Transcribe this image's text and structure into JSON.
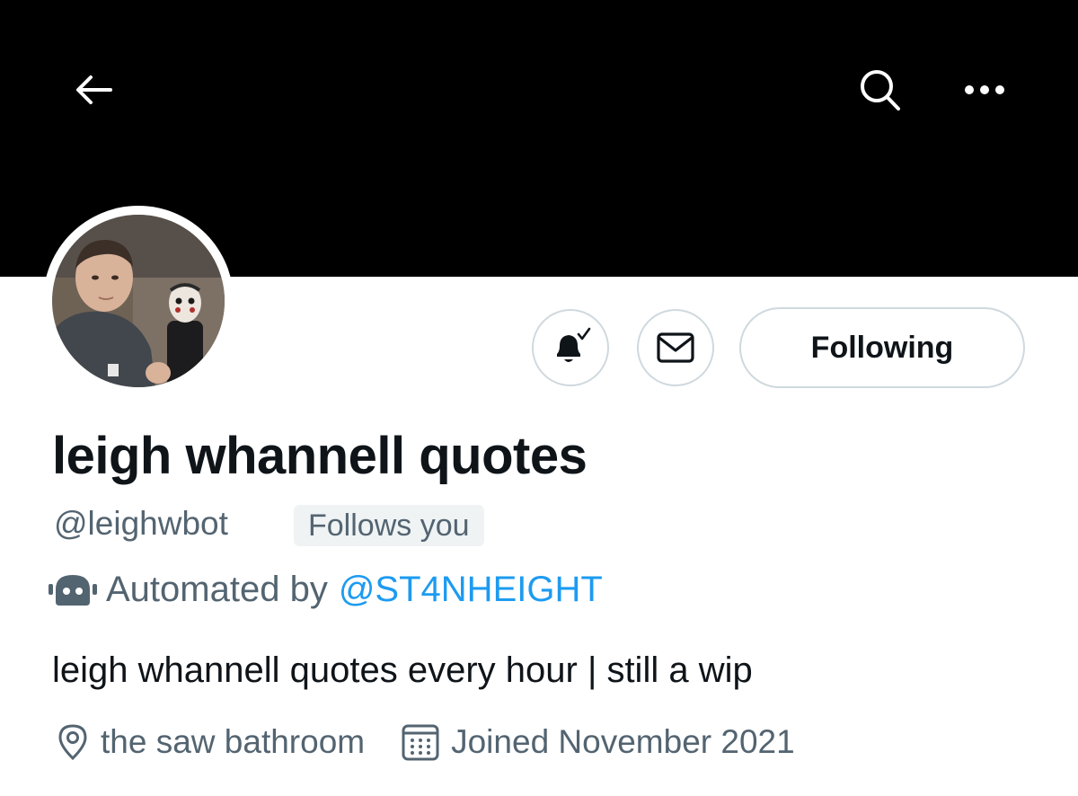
{
  "header": {
    "icons": {
      "back": "back-arrow-icon",
      "search": "search-icon",
      "more": "more-dots-icon"
    }
  },
  "profile": {
    "display_name": "leigh whannell quotes",
    "handle": "@leighwbot",
    "follows_you_badge": "Follows you",
    "automated_prefix": "Automated by",
    "automated_by": "@ST4NHEIGHT",
    "bio": "leigh whannell quotes every hour | still a wip",
    "location": "the saw bathroom",
    "joined": "Joined November 2021"
  },
  "actions": {
    "notifications_icon": "bell-check-icon",
    "message_icon": "envelope-icon",
    "following_label": "Following"
  },
  "colors": {
    "banner": "#000000",
    "text_primary": "#0f1419",
    "text_secondary": "#536471",
    "link": "#1d9bf0",
    "badge_bg": "#eff3f4",
    "border": "#cfd9de"
  }
}
